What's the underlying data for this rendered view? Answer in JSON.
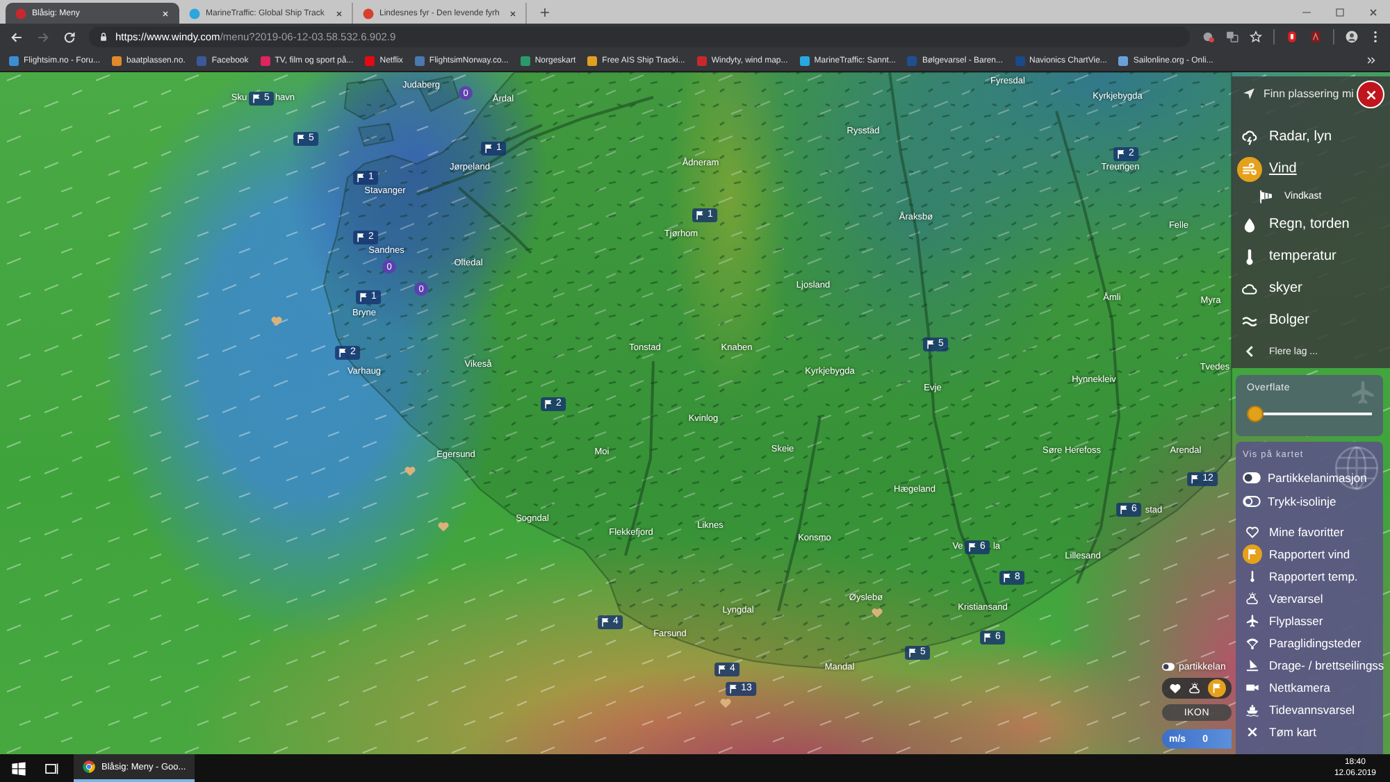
{
  "browser": {
    "tabs": [
      {
        "title": "Blåsig: Meny",
        "color": "#c8282d",
        "selected": true
      },
      {
        "title": "MarineTraffic: Global Ship Track",
        "color": "#2ba6de",
        "selected": false
      },
      {
        "title": "Lindesnes fyr - Den levende fyrh",
        "color": "#d8402e",
        "selected": false
      }
    ],
    "nav_buttons": [
      {
        "kind": "back",
        "disabled": false
      },
      {
        "kind": "forward",
        "disabled": true
      },
      {
        "kind": "reload",
        "disabled": false
      }
    ],
    "address": {
      "host": "https://www.windy.com",
      "path": "/menu?2019-06-12-03.58.532.6.902.9"
    },
    "bookmarks": [
      {
        "label": "Flightsim.no - Foru...",
        "color": "#3a8fd0"
      },
      {
        "label": "baatplassen.no.",
        "color": "#e08a2a"
      },
      {
        "label": "Facebook",
        "color": "#3b5998"
      },
      {
        "label": "TV, film og sport på...",
        "color": "#e0245e"
      },
      {
        "label": "Netflix",
        "color": "#e50914"
      },
      {
        "label": "FlightsimNorway.co...",
        "color": "#4a78b0"
      },
      {
        "label": "Norgeskart",
        "color": "#2a9a6a"
      },
      {
        "label": "Free AIS Ship Tracki...",
        "color": "#e0a020"
      },
      {
        "label": "Windyty, wind map...",
        "color": "#c8282d"
      },
      {
        "label": "MarineTraffic: Sannt...",
        "color": "#29a8e0"
      },
      {
        "label": "Bølgevarsel - Baren...",
        "color": "#1f4f8f"
      },
      {
        "label": "Navionics ChartVie...",
        "color": "#1a4a8a"
      },
      {
        "label": "Sailonline.org - Onli...",
        "color": "#6aa0d8"
      }
    ]
  },
  "map": {
    "places": [
      "Judaberg",
      "Fyresdal",
      "Sku",
      "havn",
      "Årdal",
      "Kyrkjebygda",
      "Rysstad",
      "Jørpeland",
      "Ådneram",
      "Treungen",
      "Stavanger",
      "Åraksbø",
      "Tjørhom",
      "Felle",
      "Sandnes",
      "Oltedal",
      "Ljosland",
      "Åmli",
      "Myra",
      "Bryne",
      "Tonstad",
      "Knaben",
      "Varhaug",
      "Vikeså",
      "Kyrkjebygda",
      "Tvedes",
      "Evje",
      "Hynnekleiv",
      "Kvinlog",
      "Egersund",
      "Moi",
      "Skeie",
      "Søre Herefoss",
      "Arendal",
      "Hægeland",
      "Sogndal",
      "stad",
      "Flekkefjord",
      "Liknes",
      "Konsmo",
      "Ve",
      "la",
      "Lillesand",
      "Øyslebø",
      "Lyngdal",
      "Kristiansand",
      "Farsund",
      "Mandal"
    ],
    "stations": [
      {
        "kind": "wind",
        "reading": "5"
      },
      {
        "kind": "calm",
        "reading": "0"
      },
      {
        "kind": "wind",
        "reading": "5"
      },
      {
        "kind": "wind",
        "reading": "1"
      },
      {
        "kind": "wind",
        "reading": "2"
      },
      {
        "kind": "wind",
        "reading": "1"
      },
      {
        "kind": "wind",
        "reading": "1"
      },
      {
        "kind": "wind",
        "reading": "2"
      },
      {
        "kind": "calm",
        "reading": "0"
      },
      {
        "kind": "wind",
        "reading": "1"
      },
      {
        "kind": "calm",
        "reading": "0"
      },
      {
        "kind": "wind",
        "reading": "2"
      },
      {
        "kind": "wind",
        "reading": "5"
      },
      {
        "kind": "wind",
        "reading": "2"
      },
      {
        "kind": "wind",
        "reading": "12"
      },
      {
        "kind": "wind",
        "reading": "6"
      },
      {
        "kind": "wind",
        "reading": "6"
      },
      {
        "kind": "wind",
        "reading": "8"
      },
      {
        "kind": "wind",
        "reading": "4"
      },
      {
        "kind": "wind",
        "reading": "6"
      },
      {
        "kind": "wind",
        "reading": "5"
      },
      {
        "kind": "wind",
        "reading": "4"
      },
      {
        "kind": "wind",
        "reading": "13"
      }
    ]
  },
  "layers": {
    "locate": "Finn plassering mi",
    "items": [
      {
        "kind": "radar",
        "label": "Radar, lyn",
        "selected": false
      },
      {
        "kind": "wind",
        "label": "Vind",
        "selected": true
      },
      {
        "kind": "gust",
        "label": "Vindkast",
        "selected": false
      },
      {
        "kind": "rain",
        "label": "Regn, torden",
        "selected": false
      },
      {
        "kind": "temperature",
        "label": "temperatur",
        "selected": false
      },
      {
        "kind": "clouds",
        "label": "skyer",
        "selected": false
      },
      {
        "kind": "waves",
        "label": "Bolger",
        "selected": false
      }
    ],
    "more": "Flere lag ..."
  },
  "altitude": {
    "label": "Overflate",
    "level": 0
  },
  "overlays": {
    "title": "Vis på kartet",
    "toggles": [
      {
        "label": "Partikkelanimasjon",
        "on": true
      },
      {
        "label": "Trykk-isolinje",
        "on": false
      }
    ],
    "items": [
      {
        "kind": "favorites",
        "label": "Mine favoritter",
        "selected": false
      },
      {
        "kind": "wind_reports",
        "label": "Rapportert vind",
        "selected": true
      },
      {
        "kind": "temperature_reports",
        "label": "Rapportert temp.",
        "selected": false
      },
      {
        "kind": "forecast",
        "label": "Værvarsel",
        "selected": false
      },
      {
        "kind": "airports",
        "label": "Flyplasser",
        "selected": false
      },
      {
        "kind": "paragliding",
        "label": "Paraglidingsteder",
        "selected": false
      },
      {
        "kind": "kiting",
        "label": "Drage- / brettseilingss",
        "selected": false
      },
      {
        "kind": "webcams",
        "label": "Nettkamera",
        "selected": false
      },
      {
        "kind": "tides",
        "label": "Tidevannsvarsel",
        "selected": false
      },
      {
        "kind": "clear",
        "label": "Tøm kart",
        "selected": false
      }
    ]
  },
  "map_controls": {
    "particles": {
      "label": "partikkelan",
      "on": true
    },
    "picker": [
      {
        "kind": "favorites",
        "selected": false
      },
      {
        "kind": "forecast",
        "selected": false
      },
      {
        "kind": "wind_reports",
        "selected": true
      }
    ],
    "mode": "IKON",
    "unit": "m/s",
    "value": "0"
  },
  "taskbar": {
    "app": "Blåsig: Meny - Goo...",
    "time": "18:40",
    "date": "12.06.2019"
  }
}
